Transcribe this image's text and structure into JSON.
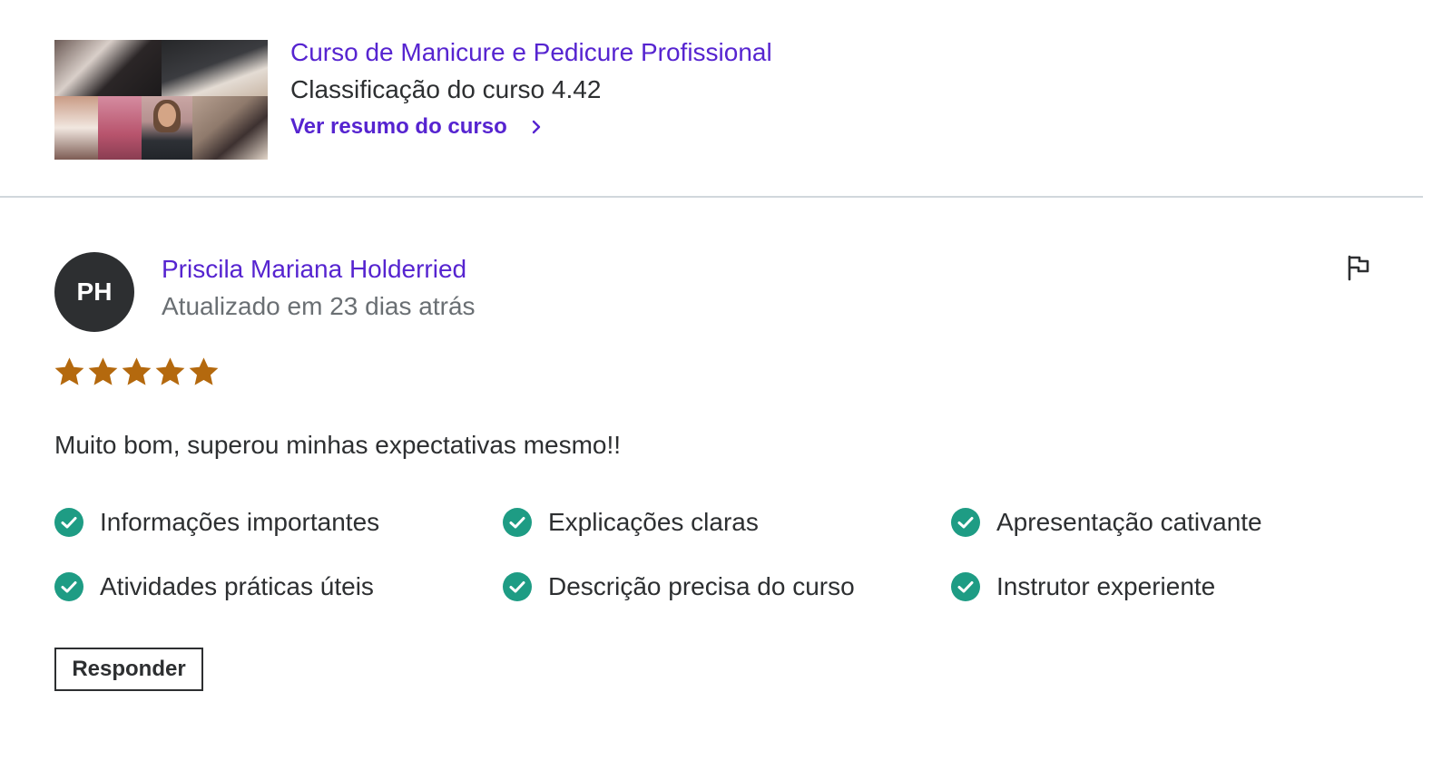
{
  "course": {
    "title": "Curso de Manicure e Pedicure Profissional",
    "rating_text": "Classificação do curso 4.42",
    "summary_link": "Ver resumo do curso"
  },
  "review": {
    "avatar_initials": "PH",
    "reviewer_name": "Priscila Mariana Holderried",
    "updated_text": "Atualizado em 23 dias atrás",
    "rating": 5,
    "rating_max": 5,
    "text": "Muito bom, superou minhas expectativas mesmo!!",
    "tags": [
      "Informações importantes",
      "Explicações claras",
      "Apresentação cativante",
      "Atividades práticas úteis",
      "Descrição precisa do curso",
      "Instrutor experiente"
    ],
    "reply_label": "Responder"
  },
  "icons": {
    "chevron": "chevron-right-icon",
    "flag": "flag-icon",
    "star": "star-icon",
    "check": "check-circle-icon"
  },
  "colors": {
    "brand_purple": "#5624d0",
    "text_dark": "#2d2f31",
    "text_muted": "#6a6f73",
    "star_orange": "#b4690e",
    "check_green": "#1e9c84",
    "divider": "#d1d7dc"
  }
}
